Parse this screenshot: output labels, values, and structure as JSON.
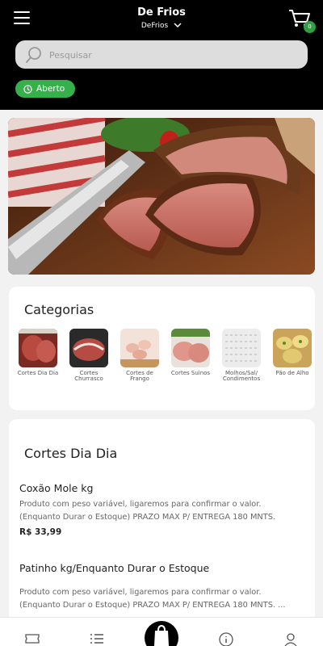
{
  "header": {
    "title": "De Frios",
    "store_selector": "DeFrios",
    "cart_count": "0"
  },
  "search": {
    "placeholder": "Pesquisar"
  },
  "status": {
    "label": "Aberto",
    "color": "#36b04a"
  },
  "categories": {
    "title": "Categorias",
    "items": [
      {
        "label": "Cortes Dia Dia"
      },
      {
        "label": "Cortes Churrasco"
      },
      {
        "label": "Cortes de Frango"
      },
      {
        "label": "Cortes Suinos"
      },
      {
        "label": "Molhos/Sal/ Condimentos"
      },
      {
        "label": "Pão de Alho"
      }
    ]
  },
  "section": {
    "title": "Cortes Dia Dia",
    "products": [
      {
        "name": "Coxão Mole kg",
        "description": "Produto com peso variável, ligaremos para confirmar o valor. (Enquanto Durar o Estoque) PRAZO MAX P/ ENTREGA 180 MNTS.",
        "price": "R$ 33,99"
      },
      {
        "name": "Patinho kg/Enquanto Durar o Estoque",
        "description": "Produto com peso variável, ligaremos para confirmar o valor. (Enquanto Durar o Estoque) PRAZO MAX P/ ENTREGA 180 MNTS. ..."
      }
    ]
  },
  "nav": {
    "items": [
      "ticket-icon",
      "list-icon",
      "bag-icon",
      "info-icon",
      "user-icon"
    ]
  }
}
